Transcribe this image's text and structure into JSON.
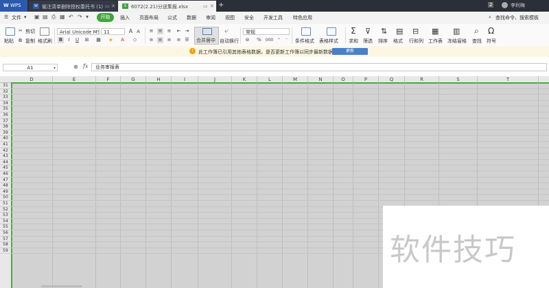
{
  "titlebar": {
    "app_label": "WPS",
    "tabs": [
      {
        "label": "催注清单删除授权委托书 (1)",
        "icon": "W",
        "icon_color": "#2b5aad"
      },
      {
        "label": "6072(2.21)分送集报.xlsx",
        "icon": "S",
        "icon_color": "#3fa43a"
      }
    ],
    "tab_pin_icon": "pin-icon",
    "tab_close_icon": "close-icon",
    "new_tab": "+",
    "badge": "2",
    "user": "李利梅"
  },
  "menubar": {
    "file_label": "文件",
    "items": [
      "开始",
      "插入",
      "页面布局",
      "公式",
      "数据",
      "审阅",
      "视图",
      "安全",
      "开发工具",
      "特色应用"
    ],
    "active_index": 0,
    "active_color": "#3fa43a",
    "search_label": "查找命令、搜索模板"
  },
  "ribbon": {
    "paste": "粘贴",
    "cut": "剪切",
    "copy": "复制",
    "format_painter": "格式刷",
    "font_name": "Arial Unicode MS",
    "font_size": "11",
    "merge_center": "合并居中",
    "auto_wrap": "自动换行",
    "number_format": "常规",
    "conditional_format": "条件格式",
    "table_style": "表格样式",
    "sum": "求和",
    "filter": "筛选",
    "sort": "排序",
    "format": "格式",
    "row_col": "行和列",
    "worksheet": "工作表",
    "freeze": "冻结窗格",
    "find": "查找",
    "symbol": "符号",
    "percent": "%",
    "thousand": "000"
  },
  "notification": {
    "message": "此工作簿已引用其他表格数据，是否更新工作簿以同步最新数据？",
    "button": "更新"
  },
  "formula_bar": {
    "cell_ref": "A1",
    "fx": "fx",
    "content": "业务审报表"
  },
  "grid": {
    "columns": [
      "D",
      "E",
      "F",
      "G",
      "H",
      "I",
      "J",
      "K",
      "L",
      "M",
      "N",
      "O",
      "P",
      "Q",
      "R",
      "S",
      "T"
    ],
    "rows": [
      "31",
      "32",
      "33",
      "34",
      "35",
      "36",
      "37",
      "38",
      "39",
      "40",
      "41",
      "42",
      "43",
      "44",
      "45",
      "46",
      "47",
      "48",
      "49",
      "50",
      "51",
      "52",
      "53",
      "54",
      "55",
      "56",
      "57",
      "58",
      "59"
    ],
    "selection_color": "#4aa845"
  },
  "watermark": "软件技巧"
}
